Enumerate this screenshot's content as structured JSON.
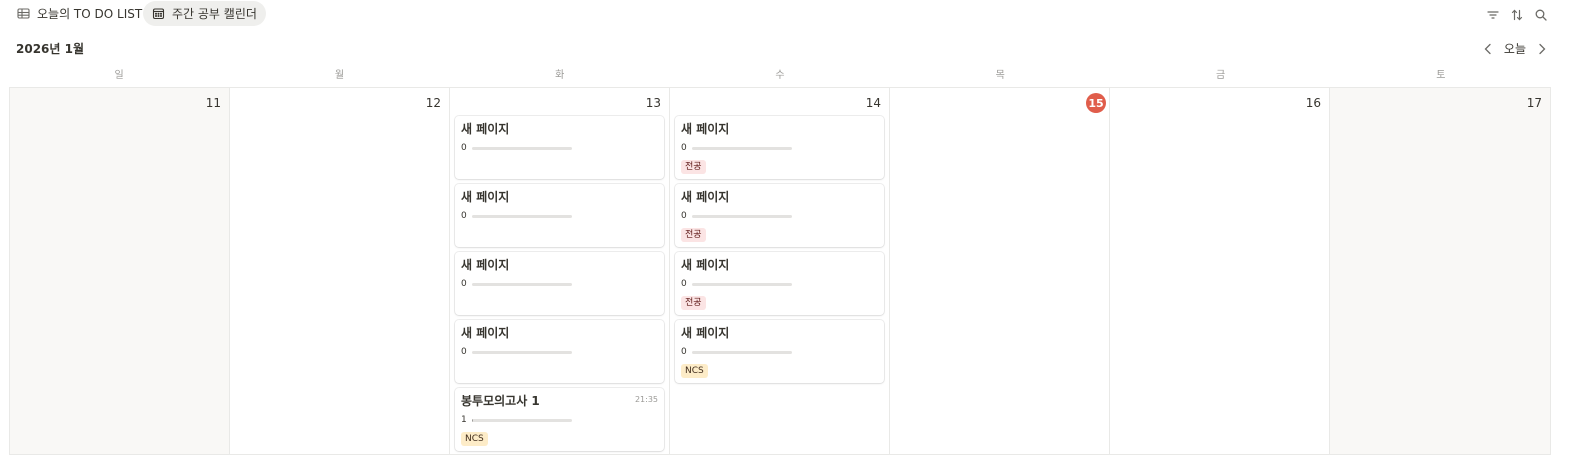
{
  "tabs": [
    {
      "label": "오늘의 TO DO LIST",
      "icon": "table-icon",
      "active": false
    },
    {
      "label": "주간 공부 캘린더",
      "icon": "calendar-icon",
      "active": true
    }
  ],
  "toolbar": {
    "icons": [
      "filter-icon",
      "sort-icon",
      "search-icon"
    ]
  },
  "calendar": {
    "month_label": "2026년 1월",
    "today_label": "오늘",
    "weekdays": [
      "일",
      "월",
      "화",
      "수",
      "목",
      "금",
      "토"
    ],
    "days": [
      {
        "num": "11",
        "weekend": true,
        "today": false,
        "cards": []
      },
      {
        "num": "12",
        "weekend": false,
        "today": false,
        "cards": []
      },
      {
        "num": "13",
        "weekend": false,
        "today": false,
        "cards": [
          {
            "title": "새 페이지",
            "progress_label": "0",
            "progress": 0,
            "tag": null,
            "time": null
          },
          {
            "title": "새 페이지",
            "progress_label": "0",
            "progress": 0,
            "tag": null,
            "time": null
          },
          {
            "title": "새 페이지",
            "progress_label": "0",
            "progress": 0,
            "tag": null,
            "time": null
          },
          {
            "title": "새 페이지",
            "progress_label": "0",
            "progress": 0,
            "tag": null,
            "time": null
          },
          {
            "title": "봉투모의고사 1",
            "progress_label": "1",
            "progress": 0.01,
            "tag": "NCS",
            "time": "21:35"
          }
        ]
      },
      {
        "num": "14",
        "weekend": false,
        "today": false,
        "cards": [
          {
            "title": "새 페이지",
            "progress_label": "0",
            "progress": 0,
            "tag": "전공",
            "time": null
          },
          {
            "title": "새 페이지",
            "progress_label": "0",
            "progress": 0,
            "tag": "전공",
            "time": null
          },
          {
            "title": "새 페이지",
            "progress_label": "0",
            "progress": 0,
            "tag": "전공",
            "time": null
          },
          {
            "title": "새 페이지",
            "progress_label": "0",
            "progress": 0,
            "tag": "NCS",
            "time": null
          }
        ]
      },
      {
        "num": "15",
        "weekend": false,
        "today": true,
        "cards": []
      },
      {
        "num": "16",
        "weekend": false,
        "today": false,
        "cards": []
      },
      {
        "num": "17",
        "weekend": true,
        "today": false,
        "cards": []
      }
    ]
  },
  "tag_colors": {
    "전공": {
      "bg": "#fbe4e4",
      "fg": "#5d1715"
    },
    "NCS": {
      "bg": "#fdecc8",
      "fg": "#402c1b"
    }
  },
  "colors": {
    "today_badge": "#e05d4b",
    "weekend_bg": "#f9f8f6",
    "active_tab_bg": "#efefed"
  }
}
